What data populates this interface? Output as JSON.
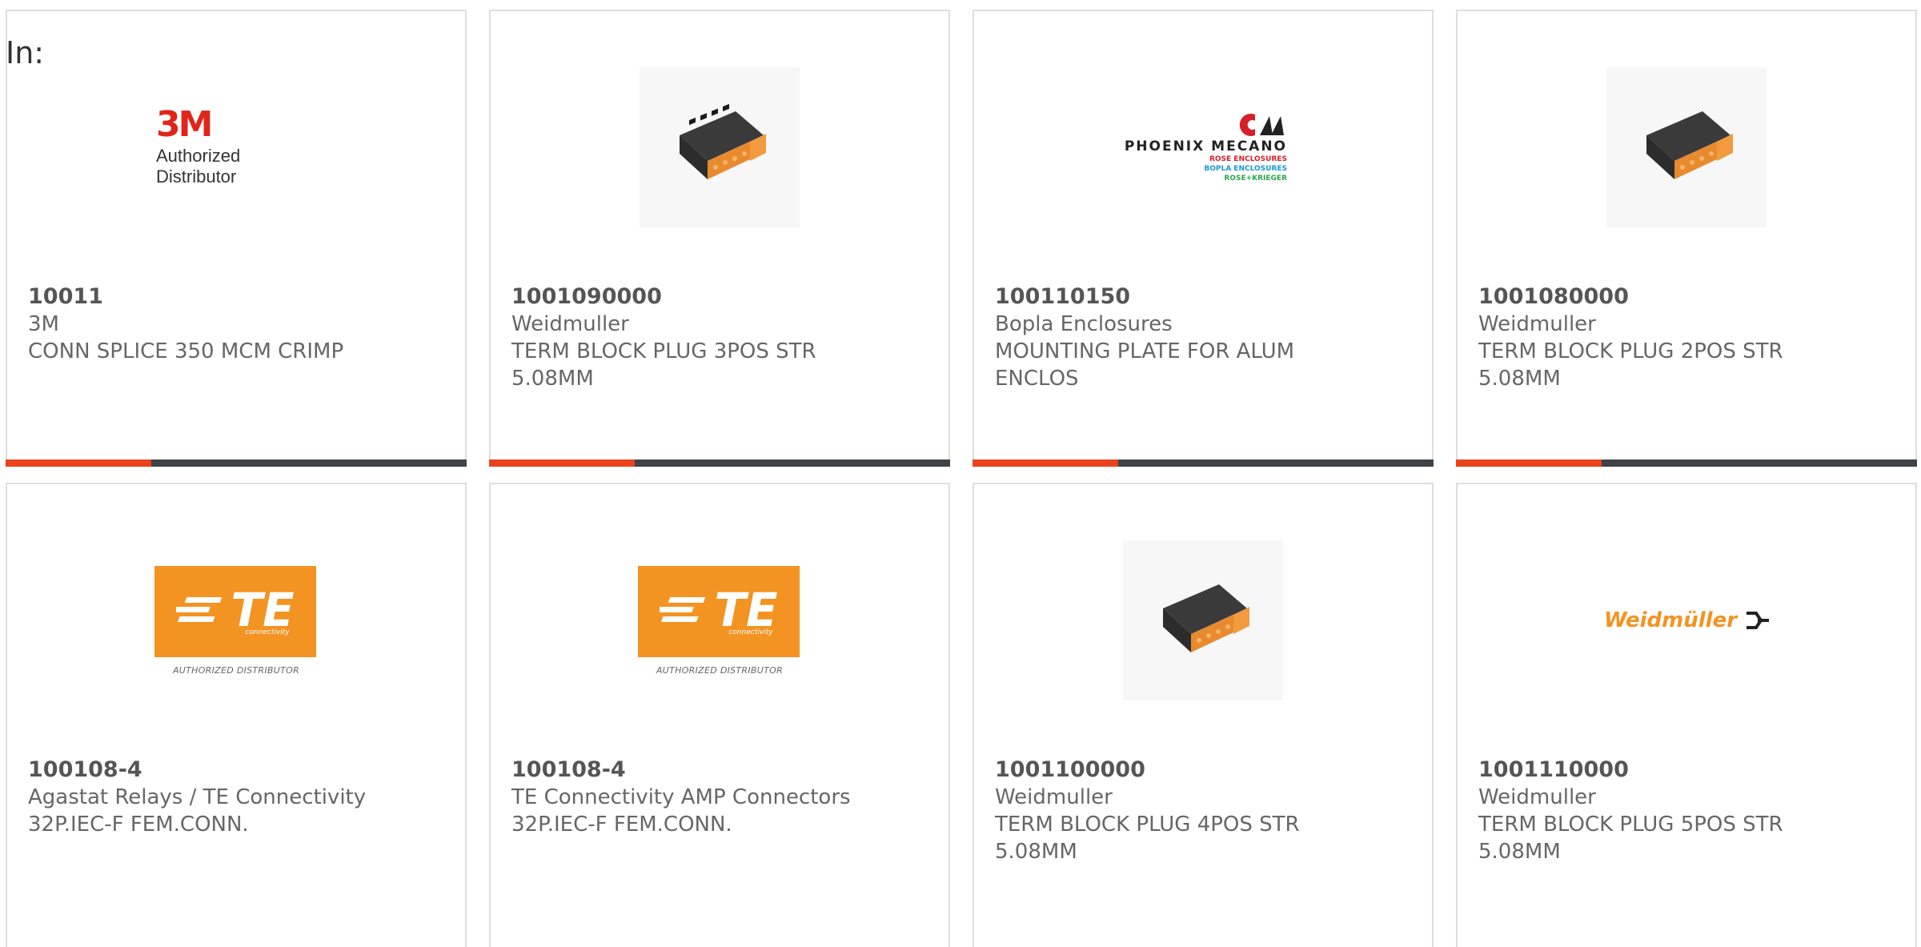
{
  "filter": {
    "label": "In:"
  },
  "colors": {
    "accent": "#e9431e",
    "bar": "#3f4347",
    "text": "#666666",
    "te_orange": "#f39322",
    "m3_red": "#e1251b"
  },
  "cards": [
    {
      "part_number": "10011",
      "manufacturer": "3M",
      "description": "CONN SPLICE 350 MCM CRIMP",
      "image": "3m-authorized-distributor-logo",
      "logo": {
        "mark": "3M",
        "sub": "Authorized Distributor"
      }
    },
    {
      "part_number": "1001090000",
      "manufacturer": "Weidmuller",
      "description": "TERM BLOCK PLUG 3POS STR 5.08MM",
      "image": "terminal-block-plug-photo"
    },
    {
      "part_number": "100110150",
      "manufacturer": "Bopla Enclosures",
      "description": "MOUNTING PLATE FOR ALUM ENCLOS",
      "image": "phoenix-mecano-logo",
      "logo": {
        "brand": "PHOENIX MECANO",
        "line1": "ROSE ENCLOSURES",
        "line2": "BOPLA ENCLOSURES",
        "line3": "ROSE+KRIEGER"
      }
    },
    {
      "part_number": "1001080000",
      "manufacturer": "Weidmuller",
      "description": "TERM BLOCK PLUG 2POS STR 5.08MM",
      "image": "terminal-block-plug-photo"
    },
    {
      "part_number": "100108-4",
      "manufacturer": "Agastat Relays / TE Connectivity",
      "description": "32P.IEC-F FEM.CONN.",
      "image": "te-connectivity-logo",
      "logo": {
        "mark": "TE",
        "sub": "connectivity",
        "auth": "AUTHORIZED DISTRIBUTOR"
      }
    },
    {
      "part_number": "100108-4",
      "manufacturer": "TE Connectivity AMP Connectors",
      "description": "32P.IEC-F FEM.CONN.",
      "image": "te-connectivity-logo",
      "logo": {
        "mark": "TE",
        "sub": "connectivity",
        "auth": "AUTHORIZED DISTRIBUTOR"
      }
    },
    {
      "part_number": "1001100000",
      "manufacturer": "Weidmuller",
      "description": "TERM BLOCK PLUG 4POS STR 5.08MM",
      "image": "terminal-block-plug-photo"
    },
    {
      "part_number": "1001110000",
      "manufacturer": "Weidmuller",
      "description": "TERM BLOCK PLUG 5POS STR 5.08MM",
      "image": "weidmuller-logo",
      "logo": {
        "mark": "Weidmüller"
      }
    }
  ]
}
